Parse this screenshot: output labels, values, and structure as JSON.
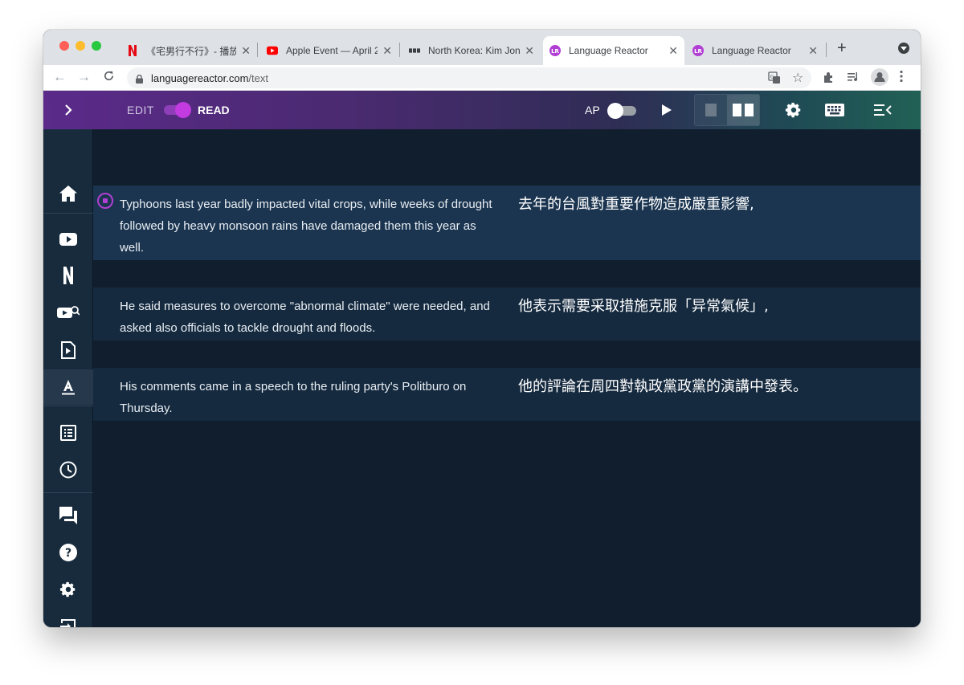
{
  "browser": {
    "tabs": [
      {
        "title": "《宅男行不行》- 播放",
        "favicon": "netflix-icon",
        "active": false
      },
      {
        "title": "Apple Event — April 2",
        "favicon": "youtube-icon",
        "active": false
      },
      {
        "title": "North Korea: Kim Jon",
        "favicon": "bbc-icon",
        "active": false
      },
      {
        "title": "Language Reactor",
        "favicon": "language-reactor-icon",
        "active": true
      },
      {
        "title": "Language Reactor",
        "favicon": "language-reactor-icon",
        "active": false
      }
    ],
    "url_host": "languagereactor.com",
    "url_path": "/text"
  },
  "header": {
    "edit_label": "EDIT",
    "read_label": "READ",
    "mode_toggle_on": true,
    "ap_label": "AP",
    "ap_toggle_on": false,
    "colors": {
      "accent": "#c23be0"
    }
  },
  "sidebar": {
    "toggle_icon": "chevron-right-icon",
    "items": [
      {
        "name": "home",
        "icon": "home-icon"
      },
      {
        "name": "youtube",
        "icon": "youtube-icon"
      },
      {
        "name": "netflix",
        "icon": "netflix-icon"
      },
      {
        "name": "video-library",
        "icon": "video-search-icon"
      },
      {
        "name": "media-file",
        "icon": "media-file-icon"
      },
      {
        "name": "text",
        "icon": "text-icon",
        "active": true
      },
      {
        "name": "list",
        "icon": "list-icon"
      },
      {
        "name": "history",
        "icon": "clock-icon"
      },
      {
        "name": "chat",
        "icon": "chat-icon"
      },
      {
        "name": "help",
        "icon": "help-icon"
      },
      {
        "name": "settings",
        "icon": "gear-icon"
      },
      {
        "name": "logout",
        "icon": "exit-icon"
      }
    ]
  },
  "sentences": [
    {
      "en": "Typhoons last year badly impacted vital crops, while weeks of drought followed by heavy monsoon rains have damaged them this year as well.",
      "zh": "去年的台風對重要作物造成嚴重影響,",
      "active": true
    },
    {
      "en": "He said measures to overcome \"abnormal climate\" were needed, and asked also officials to tackle drought and floods.",
      "zh": "他表示需要采取措施克服「异常氣候」,",
      "active": false
    },
    {
      "en": "His comments came in a speech to the ruling party's Politburo on Thursday.",
      "zh": "他的評論在周四對執政黨政黨的演講中發表。",
      "active": false
    }
  ]
}
